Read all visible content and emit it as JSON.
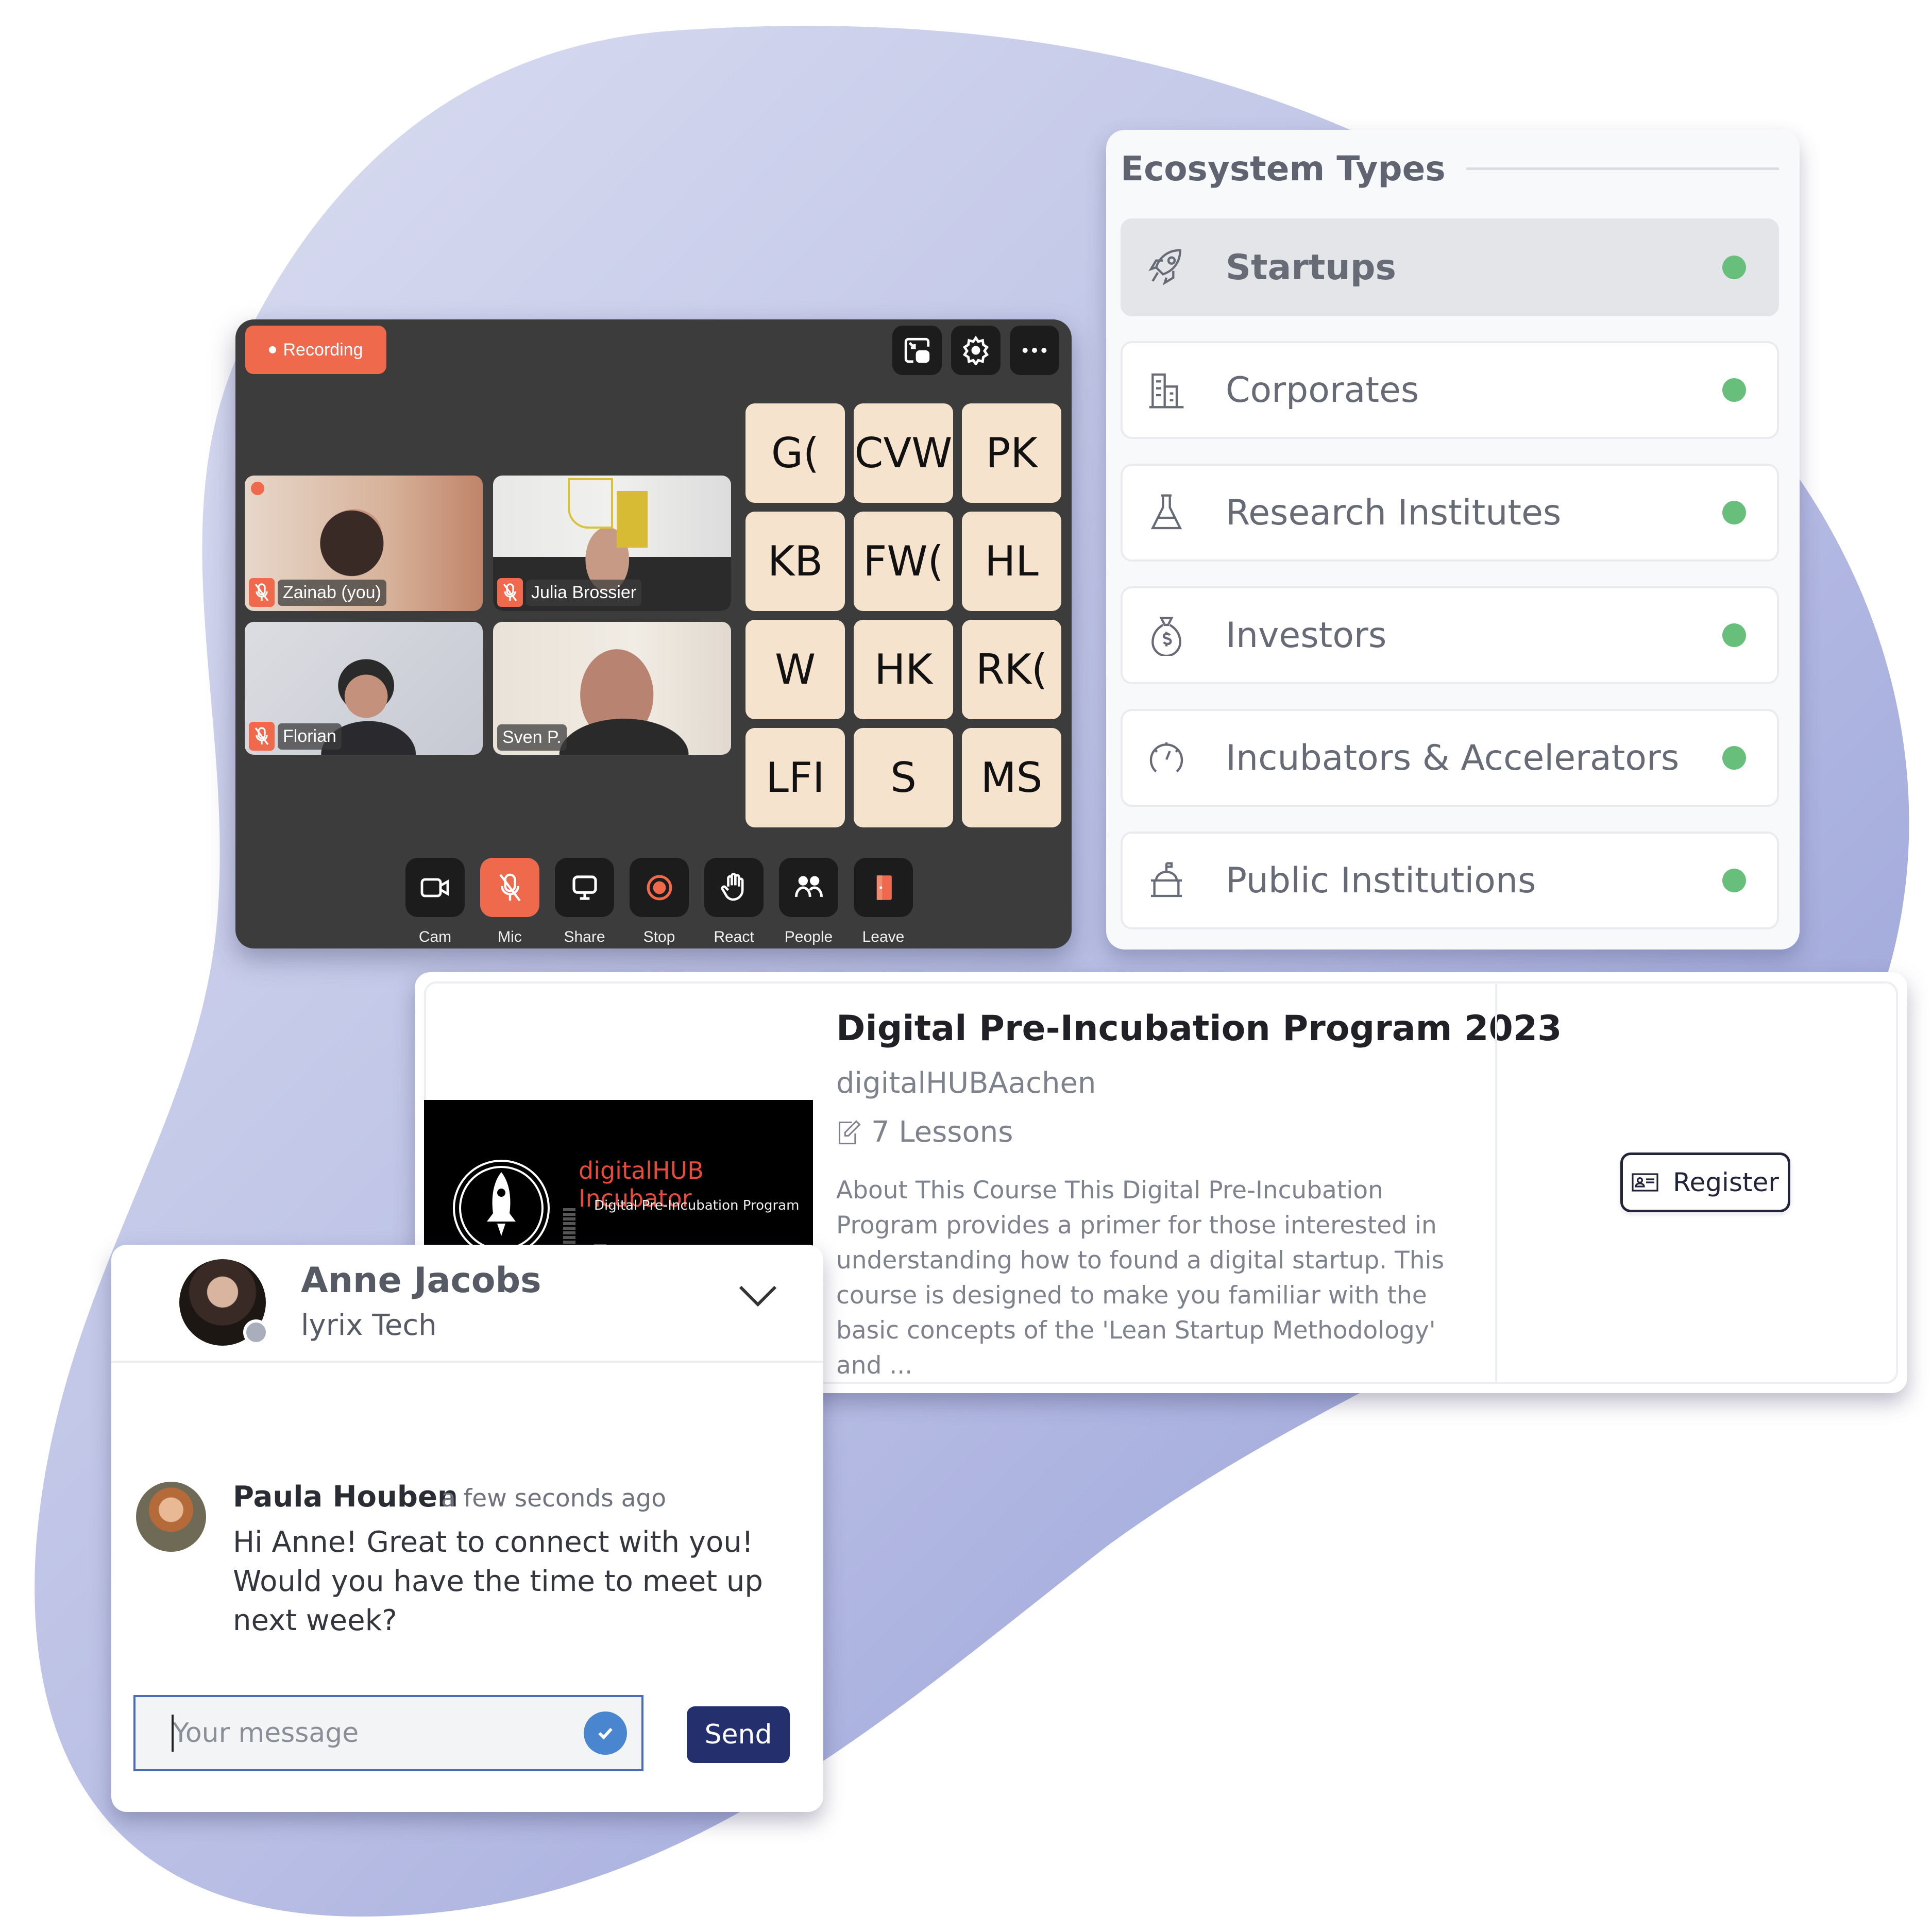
{
  "colors": {
    "accent_orange": "#ef6a4d",
    "status_green": "#67bf7b",
    "navy": "#24306e",
    "blob_light": "#d8dcf0",
    "blob_dark": "#97a0d6"
  },
  "video_call": {
    "recording_label": "Recording",
    "top_icons": [
      "picture-in-picture-icon",
      "gear-icon",
      "more-icon"
    ],
    "participants": [
      {
        "name": "Zainab (you)",
        "muted": true,
        "speaking": true
      },
      {
        "name": "Julia Brossier",
        "muted": true,
        "speaking": false
      },
      {
        "name": "Florian",
        "muted": true,
        "speaking": false
      },
      {
        "name": "Sven P.",
        "muted": false,
        "speaking": false
      }
    ],
    "initials": [
      "G(",
      "CVW",
      "PK",
      "KB",
      "FW(",
      "HL",
      "W",
      "HK",
      "RK(",
      "LFI",
      "S",
      "MS"
    ],
    "controls": [
      {
        "label": "Cam",
        "icon": "camera-icon",
        "active": false
      },
      {
        "label": "Mic",
        "icon": "mic-off-icon",
        "active": true
      },
      {
        "label": "Share",
        "icon": "screen-share-icon",
        "active": false
      },
      {
        "label": "Stop",
        "icon": "record-stop-icon",
        "active": false
      },
      {
        "label": "React",
        "icon": "hand-wave-icon",
        "active": false
      },
      {
        "label": "People",
        "icon": "people-icon",
        "active": false
      },
      {
        "label": "Leave",
        "icon": "leave-door-icon",
        "active": false
      }
    ]
  },
  "ecosystem": {
    "title": "Ecosystem Types",
    "items": [
      {
        "label": "Startups",
        "icon": "rocket-icon",
        "selected": true,
        "status": "active"
      },
      {
        "label": "Corporates",
        "icon": "buildings-icon",
        "selected": false,
        "status": "active"
      },
      {
        "label": "Research Institutes",
        "icon": "flask-icon",
        "selected": false,
        "status": "active"
      },
      {
        "label": "Investors",
        "icon": "money-bag-icon",
        "selected": false,
        "status": "active"
      },
      {
        "label": "Incubators & Accelerators",
        "icon": "speedometer-icon",
        "selected": false,
        "status": "active"
      },
      {
        "label": "Public Institutions",
        "icon": "podium-icon",
        "selected": false,
        "status": "active"
      }
    ]
  },
  "course": {
    "image_title": "digitalHUB Incubator",
    "image_subtitle": "Digital Pre-Incubation Program",
    "title": "Digital Pre-Incubation Program 2023",
    "organizer": "digitalHUBAachen",
    "lessons": "7 Lessons",
    "description": "About This Course This Digital Pre-Incubation Program provides a primer for those interested in understanding how to found a digital startup. This course is designed to make you familiar with the basic concepts of the 'Lean Startup Methodology' and ...",
    "register_label": "Register"
  },
  "chat": {
    "contact_name": "Anne Jacobs",
    "contact_org": "lyrix Tech",
    "messages": [
      {
        "sender": "Paula Houben",
        "time": "a few seconds ago",
        "text": "Hi Anne! Great to connect with you! Would you have the time to meet up next week?"
      }
    ],
    "input_placeholder": "Your message",
    "input_value": "",
    "send_label": "Send"
  }
}
